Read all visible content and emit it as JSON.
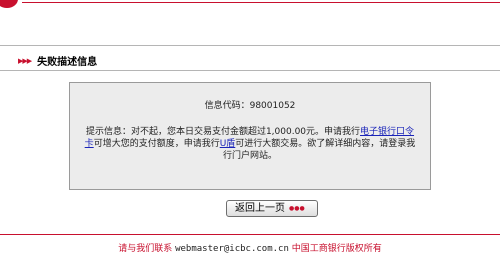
{
  "section": {
    "title": "失败描述信息"
  },
  "message": {
    "code_label": "信息代码：",
    "code": "98001052",
    "text_1": "提示信息：对不起，您本日交易支付金额超过1,000.00元。申请我行",
    "link_ecard": "电子银行口令卡",
    "text_2": "可增大您的支付额度，申请我行",
    "link_ushield": "U盾",
    "text_3": "可进行大额交易。欲了解详细内容，请登录我行门户网站。"
  },
  "back_button": {
    "label": "返回上一页"
  },
  "footer": {
    "contact": "请与我们联系",
    "email": "webmaster@icbc.com.cn",
    "copyright": "中国工商银行版权所有"
  },
  "colors": {
    "brand_red": "#c8102e",
    "box_bg": "#ececec",
    "link": "#1a24b8"
  }
}
